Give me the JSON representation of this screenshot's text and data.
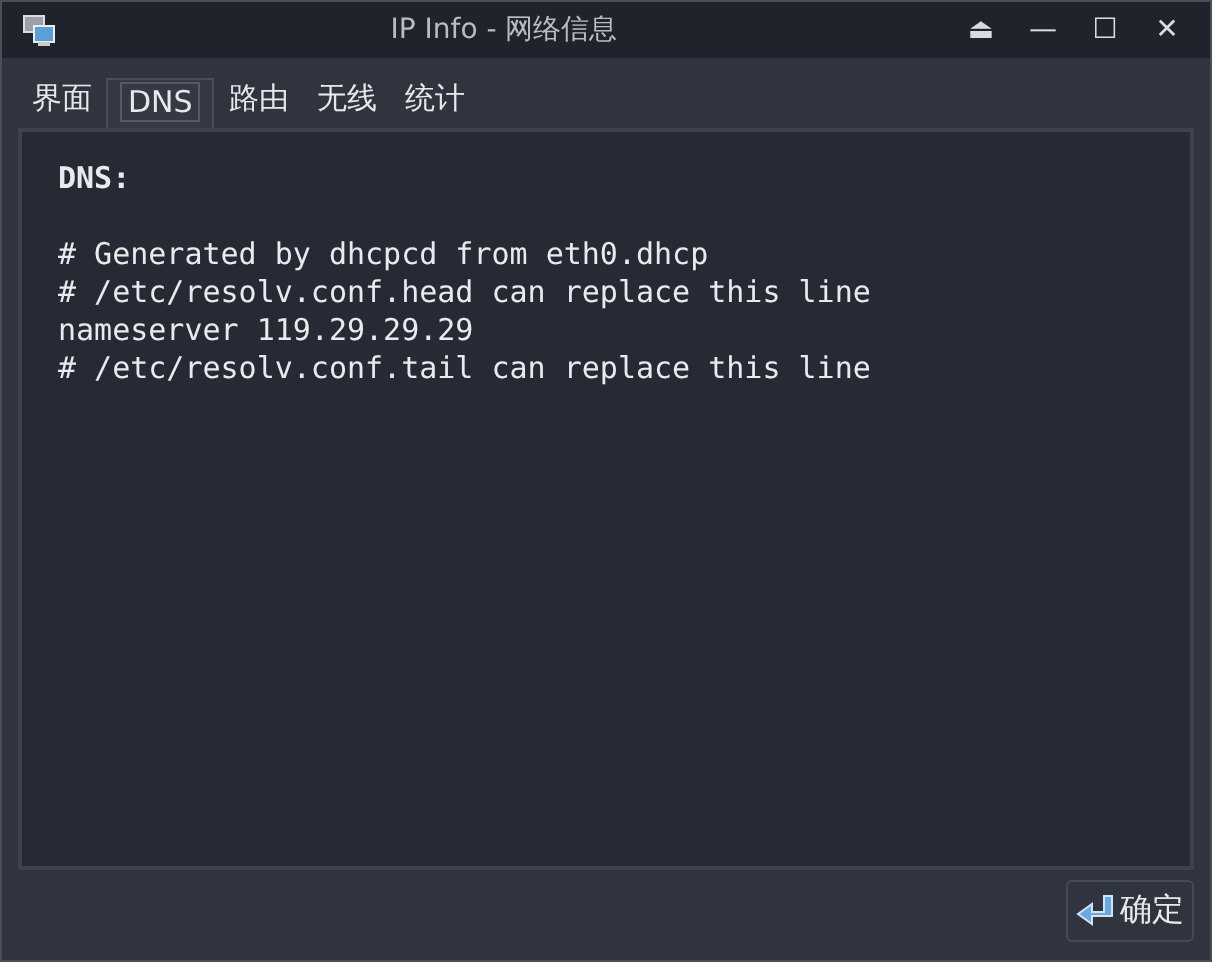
{
  "window": {
    "title": "IP Info - 网络信息",
    "controls": [
      "⏏",
      "—",
      "☐",
      "✕"
    ]
  },
  "tabs": [
    {
      "label": "界面",
      "selected": false
    },
    {
      "label": "DNS",
      "selected": true
    },
    {
      "label": "路由",
      "selected": false
    },
    {
      "label": "无线",
      "selected": false
    },
    {
      "label": "统计",
      "selected": false
    }
  ],
  "content": {
    "heading": "DNS:",
    "lines": [
      "# Generated by dhcpcd from eth0.dhcp",
      "# /etc/resolv.conf.head can replace this line",
      "nameserver 119.29.29.29",
      "# /etc/resolv.conf.tail can replace this line"
    ]
  },
  "buttons": [
    {
      "label": "确定"
    }
  ]
}
